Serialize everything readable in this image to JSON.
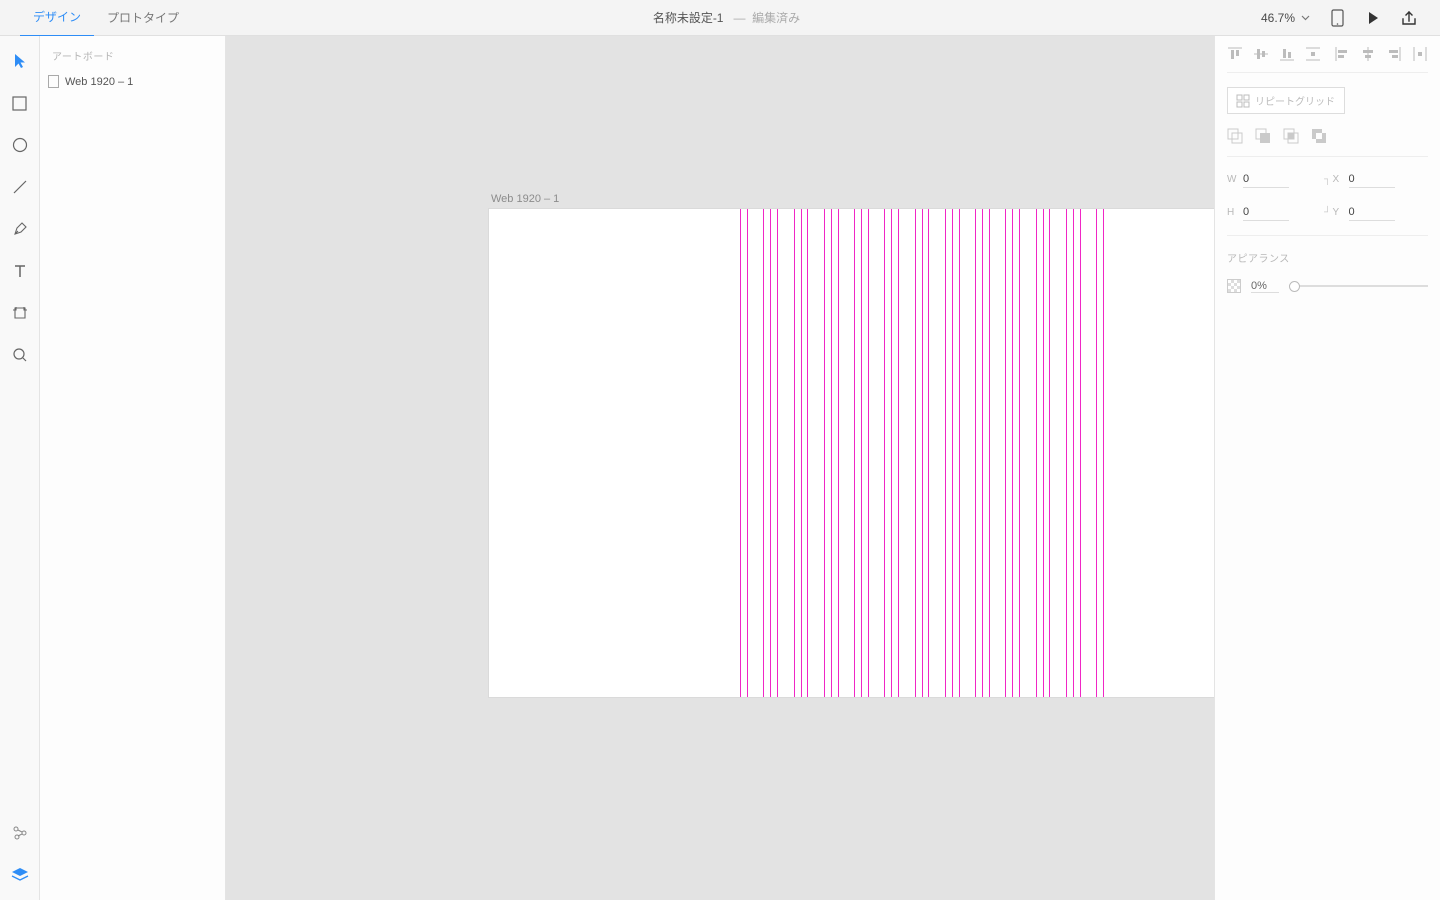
{
  "header": {
    "tabs": {
      "design": "デザイン",
      "prototype": "プロトタイプ"
    },
    "title": "名称未設定-1",
    "status_sep": "—",
    "status": "編集済み",
    "zoom": "46.7%"
  },
  "layers": {
    "section": "アートボード",
    "items": [
      "Web 1920 – 1"
    ]
  },
  "canvas": {
    "artboard_label": "Web 1920 – 1",
    "grid_columns": 12
  },
  "inspector": {
    "repeat_label": "リピートグリッド",
    "fields": {
      "w_label": "W",
      "w": "0",
      "h_label": "H",
      "h": "0",
      "x_label": "X",
      "x": "0",
      "y_label": "Y",
      "y": "0"
    },
    "appearance_label": "アピアランス",
    "opacity": "0%"
  }
}
